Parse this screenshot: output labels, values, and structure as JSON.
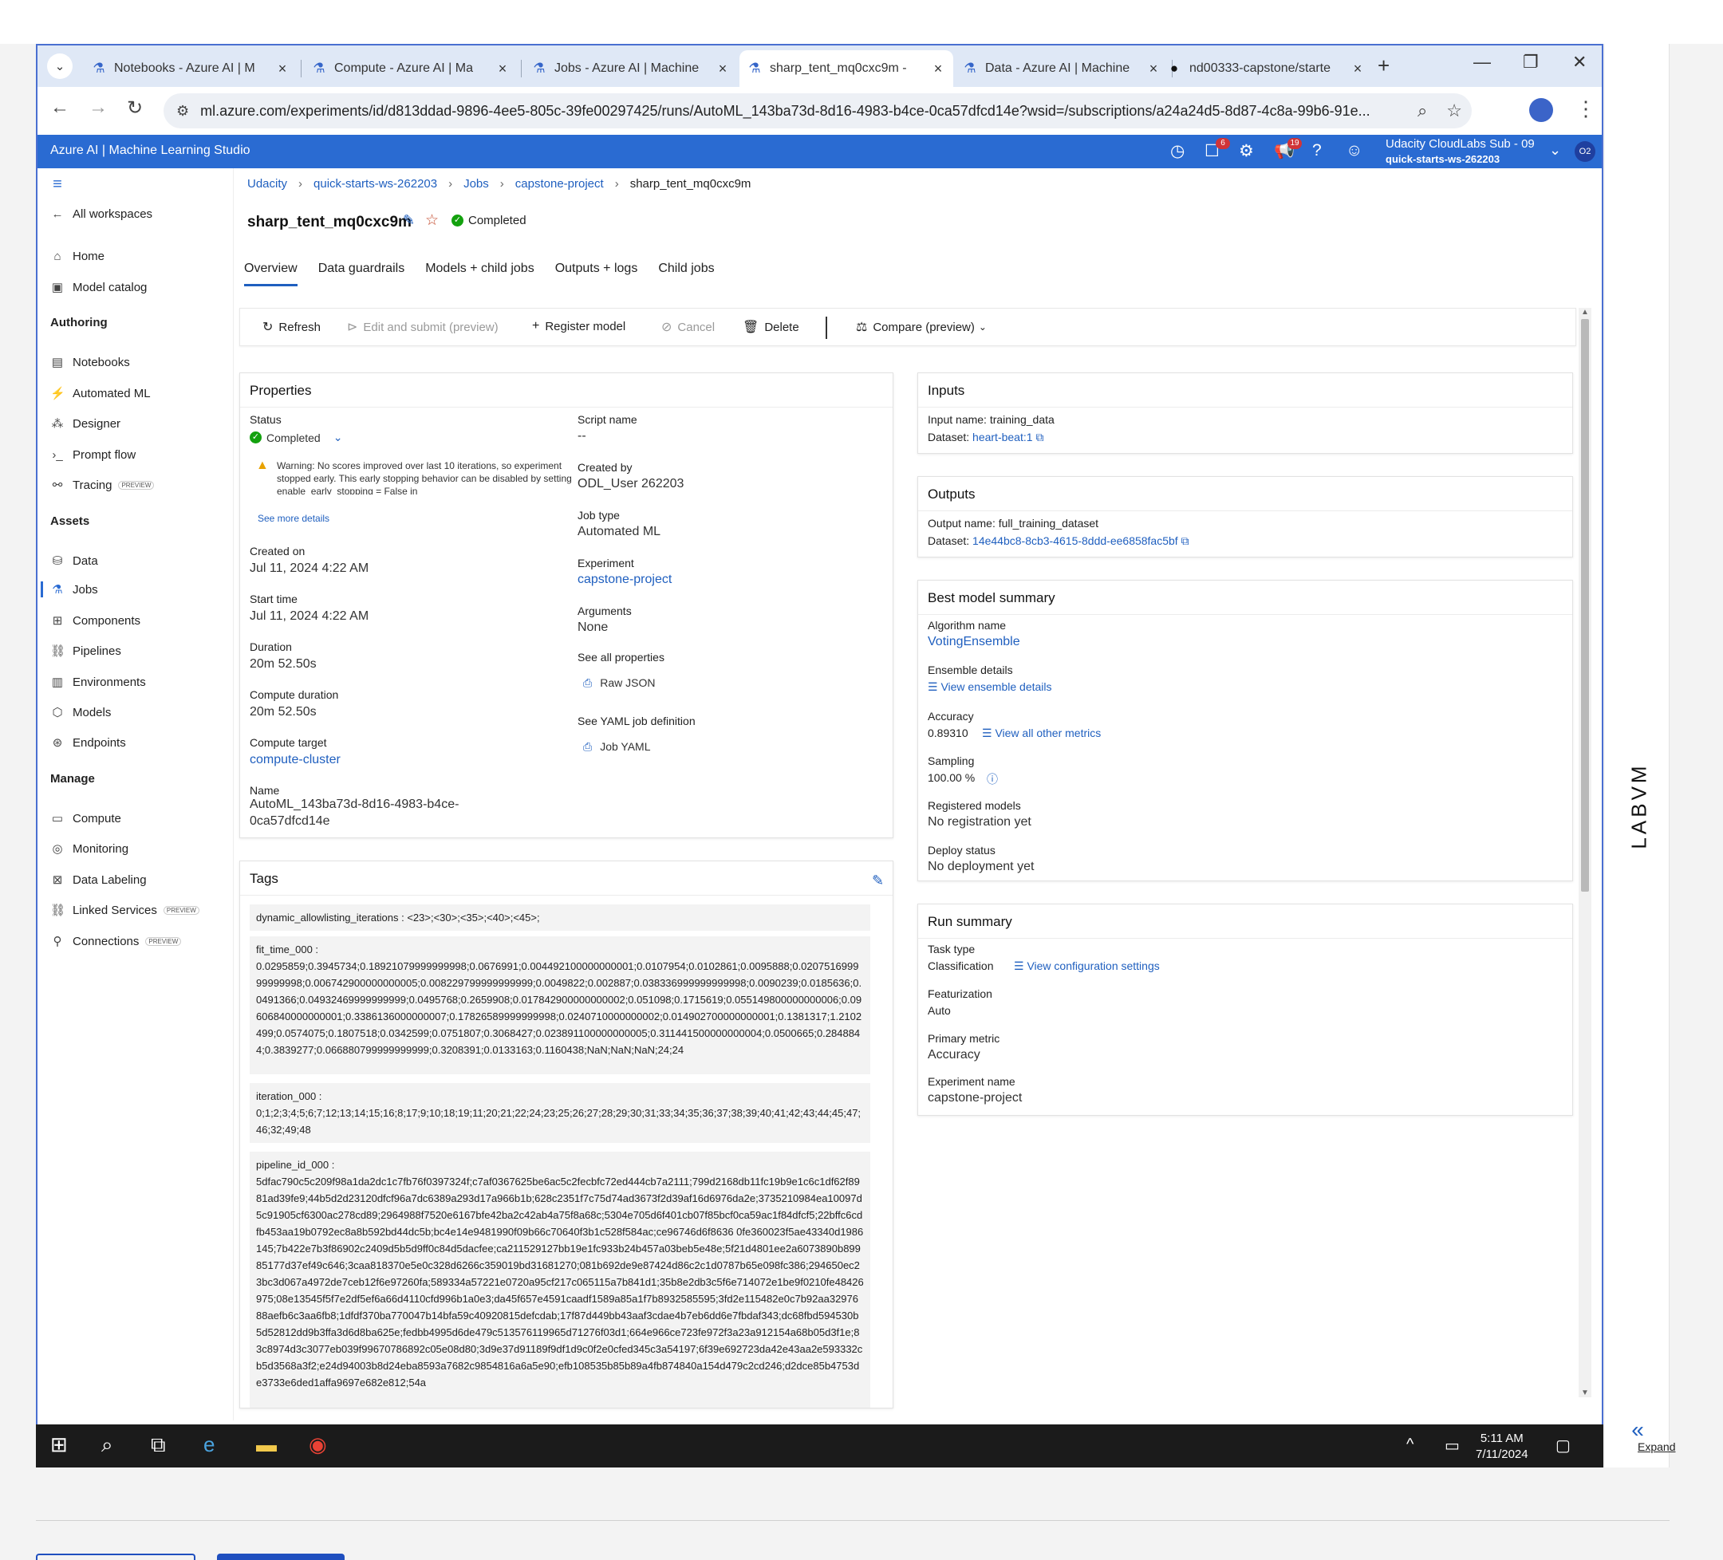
{
  "browser": {
    "tabs": [
      {
        "title": "Notebooks - Azure AI | M",
        "icon": "flask-icon"
      },
      {
        "title": "Compute - Azure AI | Ma",
        "icon": "flask-icon"
      },
      {
        "title": "Jobs - Azure AI | Machine",
        "icon": "flask-icon"
      },
      {
        "title": "sharp_tent_mq0cxc9m - ",
        "icon": "flask-icon"
      },
      {
        "title": "Data - Azure AI | Machine",
        "icon": "flask-icon"
      },
      {
        "title": "nd00333-capstone/starte",
        "icon": "github-icon"
      }
    ],
    "url": "ml.azure.com/experiments/id/d813ddad-9896-4ee5-805c-39fe00297425/runs/AutoML_143ba73d-8d16-4983-b4ce-0ca57dfcd14e?wsid=/subscriptions/a24a24d5-8d87-4c8a-99b6-91e..."
  },
  "azure": {
    "app_title": "Azure AI | Machine Learning Studio",
    "notif_badge_1": "6",
    "notif_badge_2": "19",
    "account_line1": "Udacity CloudLabs Sub - 09",
    "account_line2": "quick-starts-ws-262203",
    "avatar_initials": "O2"
  },
  "sidebar": {
    "all_workspaces": "All workspaces",
    "home": "Home",
    "model_catalog": "Model catalog",
    "authoring_heading": "Authoring",
    "notebooks": "Notebooks",
    "automated_ml": "Automated ML",
    "designer": "Designer",
    "prompt_flow": "Prompt flow",
    "tracing": "Tracing",
    "preview_badge": "PREVIEW",
    "assets_heading": "Assets",
    "data": "Data",
    "jobs": "Jobs",
    "components": "Components",
    "pipelines": "Pipelines",
    "environments": "Environments",
    "models": "Models",
    "endpoints": "Endpoints",
    "manage_heading": "Manage",
    "compute": "Compute",
    "monitoring": "Monitoring",
    "data_labeling": "Data Labeling",
    "linked_services": "Linked Services",
    "connections": "Connections"
  },
  "breadcrumb": [
    "Udacity",
    "quick-starts-ws-262203",
    "Jobs",
    "capstone-project",
    "sharp_tent_mq0cxc9m"
  ],
  "job": {
    "title": "sharp_tent_mq0cxc9m",
    "status": "Completed"
  },
  "page_tabs": [
    "Overview",
    "Data guardrails",
    "Models + child jobs",
    "Outputs + logs",
    "Child jobs"
  ],
  "toolbar": {
    "refresh": "Refresh",
    "edit_submit": "Edit and submit (preview)",
    "register_model": "Register model",
    "cancel": "Cancel",
    "delete": "Delete",
    "compare": "Compare (preview)"
  },
  "properties": {
    "title": "Properties",
    "status_label": "Status",
    "status_value": "Completed",
    "warning": "Warning: No scores improved over last 10 iterations, so experiment stopped early. This early stopping behavior can be disabled by setting enable_early_stopping = False in",
    "see_more": "See more details",
    "created_on_label": "Created on",
    "created_on": "Jul 11, 2024 4:22 AM",
    "start_time_label": "Start time",
    "start_time": "Jul 11, 2024 4:22 AM",
    "duration_label": "Duration",
    "duration": "20m 52.50s",
    "compute_duration_label": "Compute duration",
    "compute_duration": "20m 52.50s",
    "compute_target_label": "Compute target",
    "compute_target": "compute-cluster",
    "name_label": "Name",
    "name_line1": "AutoML_143ba73d-8d16-4983-b4ce-",
    "name_line2": "0ca57dfcd14e",
    "script_name_label": "Script name",
    "script_name": "--",
    "created_by_label": "Created by",
    "created_by": "ODL_User 262203",
    "job_type_label": "Job type",
    "job_type": "Automated ML",
    "experiment_label": "Experiment",
    "experiment": "capstone-project",
    "arguments_label": "Arguments",
    "arguments": "None",
    "see_all_props_label": "See all properties",
    "raw_json": "Raw JSON",
    "see_yaml_label": "See YAML job definition",
    "job_yaml": "Job YAML"
  },
  "inputs": {
    "title": "Inputs",
    "input_name": "Input name: training_data",
    "dataset_label": "Dataset:",
    "dataset_link": "heart-beat:1"
  },
  "outputs": {
    "title": "Outputs",
    "output_name": "Output name: full_training_dataset",
    "dataset_label": "Dataset:",
    "dataset_link": "14e44bc8-8cb3-4615-8ddd-ee6858fac5bf"
  },
  "best_model": {
    "title": "Best model summary",
    "algorithm_label": "Algorithm name",
    "algorithm": "VotingEnsemble",
    "ensemble_label": "Ensemble details",
    "ensemble_link": "View ensemble details",
    "accuracy_label": "Accuracy",
    "accuracy": "0.89310",
    "metrics_link": "View all other metrics",
    "sampling_label": "Sampling",
    "sampling": "100.00 %",
    "registered_label": "Registered models",
    "registered": "No registration yet",
    "deploy_label": "Deploy status",
    "deploy": "No deployment yet"
  },
  "run_summary": {
    "title": "Run summary",
    "task_type_label": "Task type",
    "task_type": "Classification",
    "config_link": "View configuration settings",
    "featurization_label": "Featurization",
    "featurization": "Auto",
    "primary_metric_label": "Primary metric",
    "primary_metric": "Accuracy",
    "experiment_name_label": "Experiment name",
    "experiment_name": "capstone-project"
  },
  "tags": {
    "title": "Tags",
    "dynamic": "dynamic_allowlisting_iterations : <23>;<30>;<35>;<40>;<45>;",
    "fit_time_key": "fit_time_000 :",
    "fit_time_value": "0.0295859;0.3945734;0.18921079999999998;0.0676991;0.004492100000000001;0.0107954;0.0102861;0.0095888;0.020751699999999998;0.006742900000000005;0.008229799999999999;0.0049822;0.002887;0.038336999999999998;0.0090239;0.0185636;0.0491366;0.04932469999999999;0.0495768;0.2659908;0.017842900000000002;0.051098;0.1715619;0.055149800000000006;0.09606840000000001;0.3386136000000007;0.17826589999999998;0.0240710000000002;0.014902700000000001;0.1381317;1.2102499;0.0574075;0.1807518;0.0342599;0.0751807;0.3068427;0.023891100000000005;0.311441500000000004;0.0500665;0.2848844;0.3839277;0.066880799999999999;0.3208391;0.0133163;0.1160438;NaN;NaN;NaN;24;24",
    "iteration_key": "iteration_000 :",
    "iteration_value": "0;1;2;3;4;5;6;7;12;13;14;15;16;8;17;9;10;18;19;11;20;21;22;24;23;25;26;27;28;29;30;31;33;34;35;36;37;38;39;40;41;42;43;44;45;47;46;32;49;48",
    "pipeline_key": "pipeline_id_000 :",
    "pipeline_value": "5dfac790c5c209f98a1da2dc1c7fb76f0397324f;c7af0367625be6ac5c2fecbfc72ed444cb7a2111;799d2168db11fc19b9e1c6c1df62f8981ad39fe9;44b5d2d23120dfcf96a7dc6389a293d17a966b1b;628c2351f7c75d74ad3673f2d39af16d6976da2e;3735210984ea10097d5c91905cf6300ac278cd89;2964988f7520e6167bfe42ba2c42ab4a75f8a68c;5304e705d6f401cb07f85bcf0ca59ac1f84dfcf5;22bffc6cdfb453aa19b0792ec8a8b592bd44dc5b;bc4e14e9481990f09b66c70640f3b1c528f584ac;ce96746d6f8636 0fe360023f5ae43340d1986145;7b422e7b3f86902c2409d5b5d9ff0c84d5dacfee;ca211529127bb19e1fc933b24b457a03beb5e48e;5f21d4801ee2a6073890b89985177d37ef49c646;3caa818370e5e0c328d6266c359019bd31681270;081b692de9e87424d86c2c1d0787b65e098fc386;294650ec23bc3d067a4972de7ceb12f6e97260fa;589334a57221e0720a95cf217c065115a7b841d1;35b8e2db3c5f6e714072e1be9f0210fe48426975;08e13545f5f7e2df5ef6a66d4110cfd996b1a0e3;da45f657e4591caadf1589a85a1f7b8932585595;3fd2e115482e0c7b92aa3297688aefb6c3aa6fb8;1dfdf370ba770047b14bfa59c40920815defcdab;17f87d449bb43aaf3cdae4b7eb6dd6e7fbdaf343;dc68fbd594530b5d52812dd9b3ffa3d6d8ba625e;fedbb4995d6de479c513576119965d71276f03d1;664e966ce723fe972f3a23a912154a68b05d3f1e;83c8974d3c3077eb039f99670786892c05e08d80;3d9e37d91189f9df1d9c0f2e0cfed345c3a54197;6f39e692723da42e43aa2e593332cb5d3568a3f2;e24d94003b8d24eba8593a7682c9854816a6a5e90;efb108535b85b89a4fb874840a154d479c2cd246;d2dce85b4753de3733e6ded1affa9697e682e812;54a"
  },
  "taskbar": {
    "time": "5:11 AM",
    "date": "7/11/2024"
  },
  "outer": {
    "labvm": "LABVM",
    "expand": "Expand"
  }
}
